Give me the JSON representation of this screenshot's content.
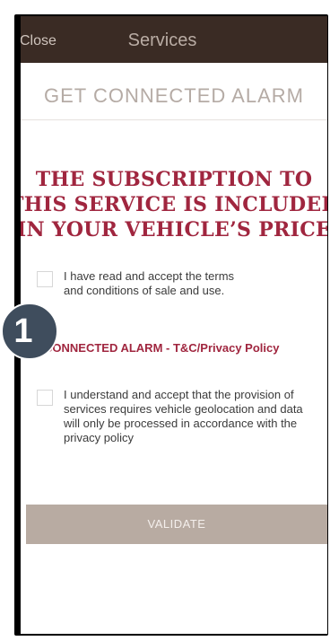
{
  "header": {
    "close_label": "Close",
    "title": "Services"
  },
  "subtitle": "GET CONNECTED ALARM",
  "headline": {
    "line1": "THE SUBSCRIPTION TO",
    "line2": "THIS SERVICE IS INCLUDED",
    "line3": "IN YOUR VEHICLE’S PRICE"
  },
  "terms": {
    "line1": "I have read and accept the terms",
    "line2": "and conditions of sale and use."
  },
  "policy_link": "CONNECTED ALARM - T&C/Privacy Policy",
  "geolocation": {
    "line1": "I understand and accept that the provision of",
    "line2": "services requires vehicle geolocation and data",
    "line3": "will only be processed in accordance with the",
    "line4": "privacy policy"
  },
  "validate_label": "VALIDATE",
  "step_badge": "1",
  "colors": {
    "header_bg": "#3a2b24",
    "accent": "#a0263f",
    "button_bg": "#b8aba2",
    "badge_bg": "#3f4d5d"
  }
}
